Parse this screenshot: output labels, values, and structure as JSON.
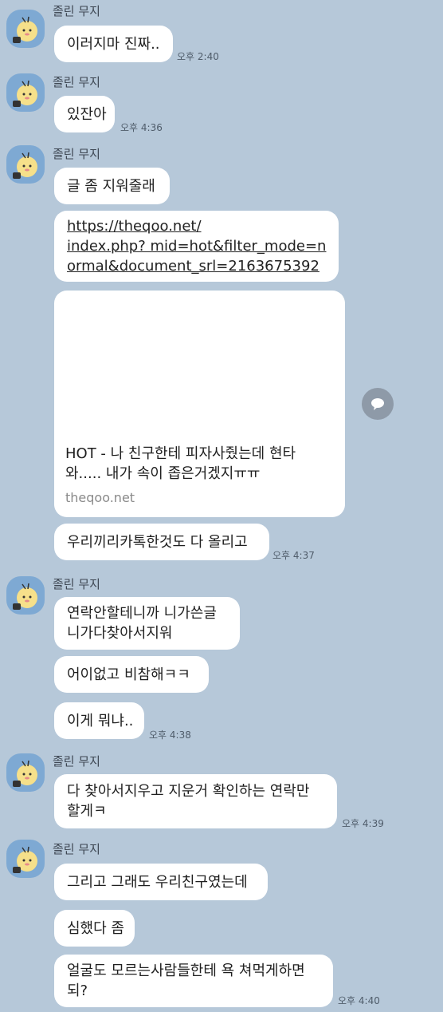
{
  "sender_name": "졸린 무지",
  "messages": [
    {
      "text": "이러지마 진짜..",
      "time": "오후 2:40"
    },
    {
      "text": "있잔아",
      "time": "오후 4:36"
    },
    {
      "text": "글 좀 지워줄래"
    },
    {
      "lines": [
        "https://theqoo.net/",
        "index.php? mid=hot&filter_mode=n",
        "ormal&document_srl=2163675392"
      ]
    },
    {
      "text": "우리끼리카톡한것도 다 올리고",
      "time": "오후 4:37"
    },
    {
      "lines": [
        "연락안할테니까 니가쓴글",
        "니가다찾아서지워"
      ]
    },
    {
      "text": "어이없고 비참해ㅋㅋ"
    },
    {
      "text": "이게 뭐냐..",
      "time": "오후 4:38"
    },
    {
      "lines": [
        "다 찾아서지우고 지운거 확인하는 연락만",
        "할게ㅋ"
      ],
      "time": "오후 4:39"
    },
    {
      "text": "그리고 그래도 우리친구였는데"
    },
    {
      "text": "심했다 좀"
    },
    {
      "lines": [
        "얼굴도 모르는사람들한테 욕 쳐먹게하면",
        "되?"
      ],
      "time": "오후 4:40"
    }
  ],
  "link_preview": {
    "title_lines": [
      "HOT - 나 친구한테 피자사줬는데 현타",
      "와..... 내가 속이 좁은거겠지ㅠㅠ"
    ],
    "domain": "theqoo.net"
  },
  "icons": {
    "avatar": "muzi-avatar-icon",
    "share": "share-bubble-icon"
  },
  "colors": {
    "background": "#b6c8d9",
    "bubble": "#ffffff",
    "avatar_bg": "#7ea9d3"
  }
}
